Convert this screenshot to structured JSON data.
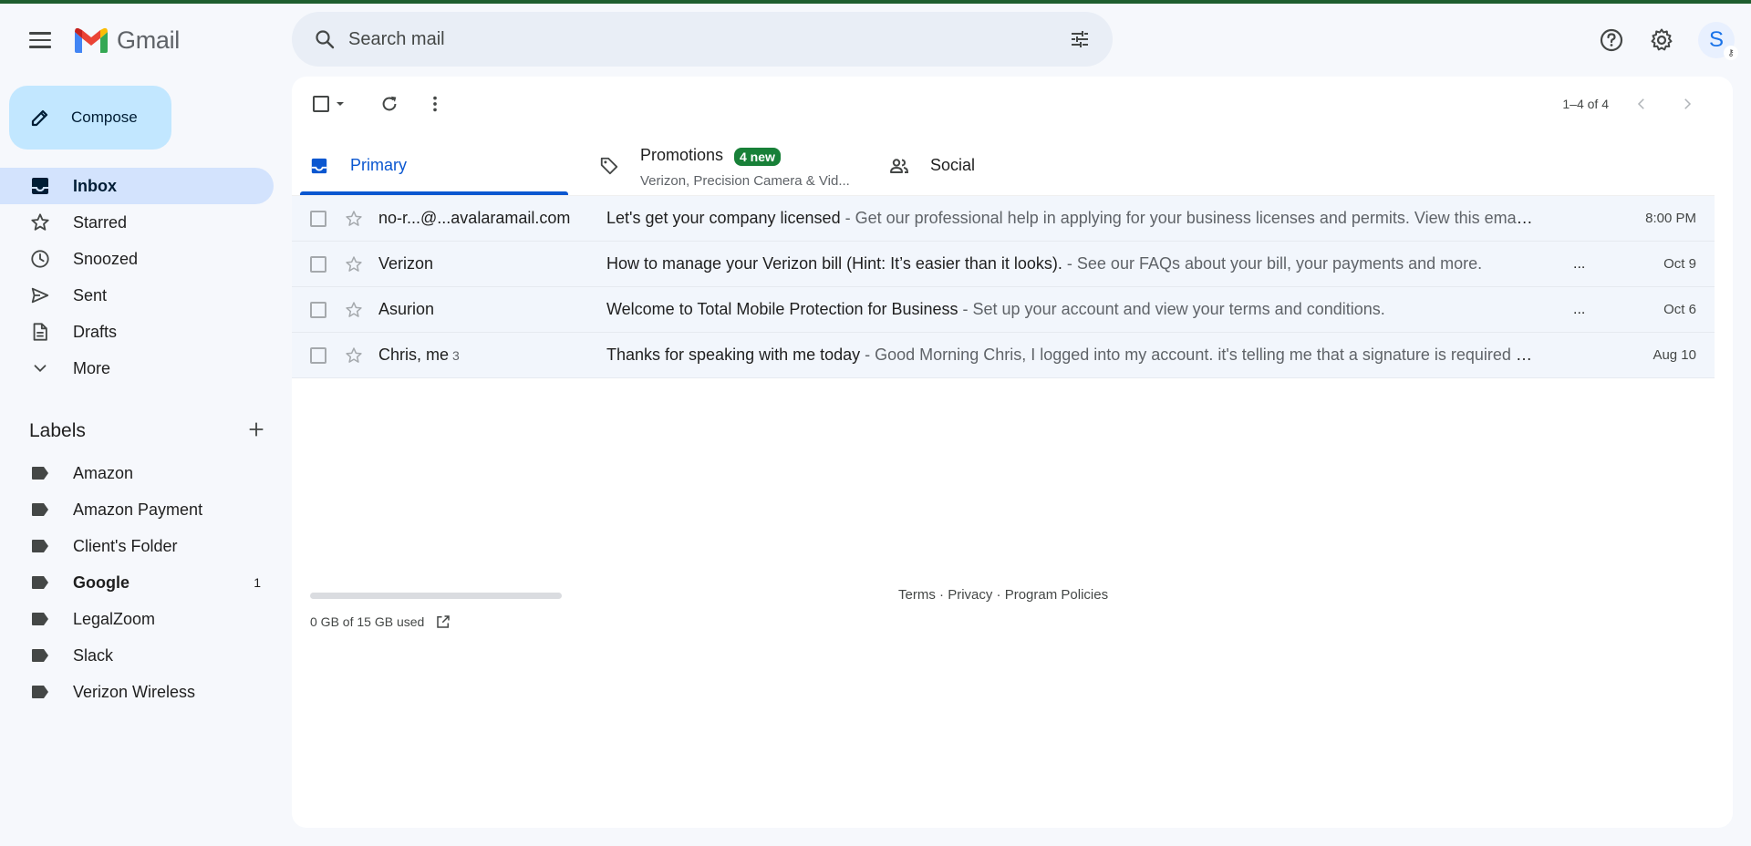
{
  "app": {
    "name": "Gmail"
  },
  "search": {
    "placeholder": "Search mail"
  },
  "account": {
    "initial": "S"
  },
  "compose": {
    "label": "Compose"
  },
  "nav": {
    "items": [
      {
        "label": "Inbox",
        "icon": "inbox-icon",
        "active": true
      },
      {
        "label": "Starred",
        "icon": "star-icon"
      },
      {
        "label": "Snoozed",
        "icon": "clock-icon"
      },
      {
        "label": "Sent",
        "icon": "send-icon"
      },
      {
        "label": "Drafts",
        "icon": "draft-icon"
      },
      {
        "label": "More",
        "icon": "chevron-down-icon"
      }
    ]
  },
  "labels": {
    "heading": "Labels",
    "items": [
      {
        "label": "Amazon",
        "count": ""
      },
      {
        "label": "Amazon Payment",
        "count": ""
      },
      {
        "label": "Client's Folder",
        "count": ""
      },
      {
        "label": "Google",
        "count": "1",
        "bold": true
      },
      {
        "label": "LegalZoom",
        "count": ""
      },
      {
        "label": "Slack",
        "count": ""
      },
      {
        "label": "Verizon Wireless",
        "count": ""
      }
    ]
  },
  "toolbar": {
    "pager": "1–4 of 4"
  },
  "tabs": [
    {
      "label": "Primary",
      "icon": "inbox-icon",
      "active": true
    },
    {
      "label": "Promotions",
      "icon": "tag-icon",
      "badge": "4 new",
      "subtitle": "Verizon, Precision Camera & Vid..."
    },
    {
      "label": "Social",
      "icon": "people-icon"
    }
  ],
  "emails": [
    {
      "sender": "no-r...@...avalaramail.com",
      "count": "",
      "subject": "Let's get your company licensed",
      "snippet": " - Get our professional help in applying for your business licenses and permits. View this email in your ...",
      "dots": "",
      "date": "8:00 PM"
    },
    {
      "sender": "Verizon",
      "count": "",
      "subject": "How to manage your Verizon bill (Hint: It’s easier than it looks).",
      "snippet": " - See our FAQs about your bill, your payments and more.",
      "dots": "...",
      "date": "Oct 9"
    },
    {
      "sender": "Asurion",
      "count": "",
      "subject": "Welcome to Total Mobile Protection for Business",
      "snippet": " - Set up your account and view your terms and conditions.",
      "dots": "...",
      "date": "Oct 6"
    },
    {
      "sender": "Chris, me",
      "count": "3",
      "subject": "Thanks for speaking with me today",
      "snippet": " - Good Morning Chris, I logged into my account. it's telling me that a signature is required but i don...",
      "dots": "",
      "date": "Aug 10"
    }
  ],
  "storage": {
    "text": "0 GB of 15 GB used",
    "used_fraction": 0
  },
  "footer": {
    "terms": "Terms",
    "sep1": " · ",
    "privacy": "Privacy",
    "sep2": " · ",
    "policies": "Program Policies"
  },
  "colors": {
    "accent": "#0b57d0",
    "compose_bg": "#c2e7ff",
    "active_nav": "#d3e3fd",
    "badge": "#188038"
  }
}
